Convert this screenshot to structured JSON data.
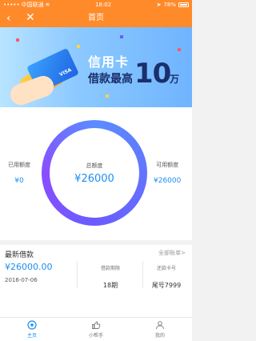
{
  "status": {
    "carrier": "中国联通",
    "time": "18:02",
    "battery": "78%"
  },
  "nav": {
    "title": "首页",
    "back_icon": "‹",
    "close_icon": "✕"
  },
  "banner": {
    "line1": "信用卡",
    "line2": "借款最高",
    "amount": "10",
    "unit": "万"
  },
  "summary": {
    "used_label": "已用额度",
    "used_value": "¥0",
    "total_label": "总额度",
    "total_value": "¥26000",
    "available_label": "可用额度",
    "available_value": "¥26000"
  },
  "loan": {
    "title": "最新借款",
    "all_bills": "全部账单>",
    "amount": "¥26000.00",
    "date": "2016-07-06",
    "term_label": "借款期限",
    "term_value": "18期",
    "card_label": "还款卡号",
    "card_value": "尾号7999"
  },
  "tabs": [
    {
      "label": "主页",
      "icon": "home-circle-icon"
    },
    {
      "label": "小帮手",
      "icon": "thumb-up-icon"
    },
    {
      "label": "我的",
      "icon": "user-icon"
    }
  ],
  "colors": {
    "accent": "#ff8a2a",
    "primary": "#1e8ef0"
  }
}
